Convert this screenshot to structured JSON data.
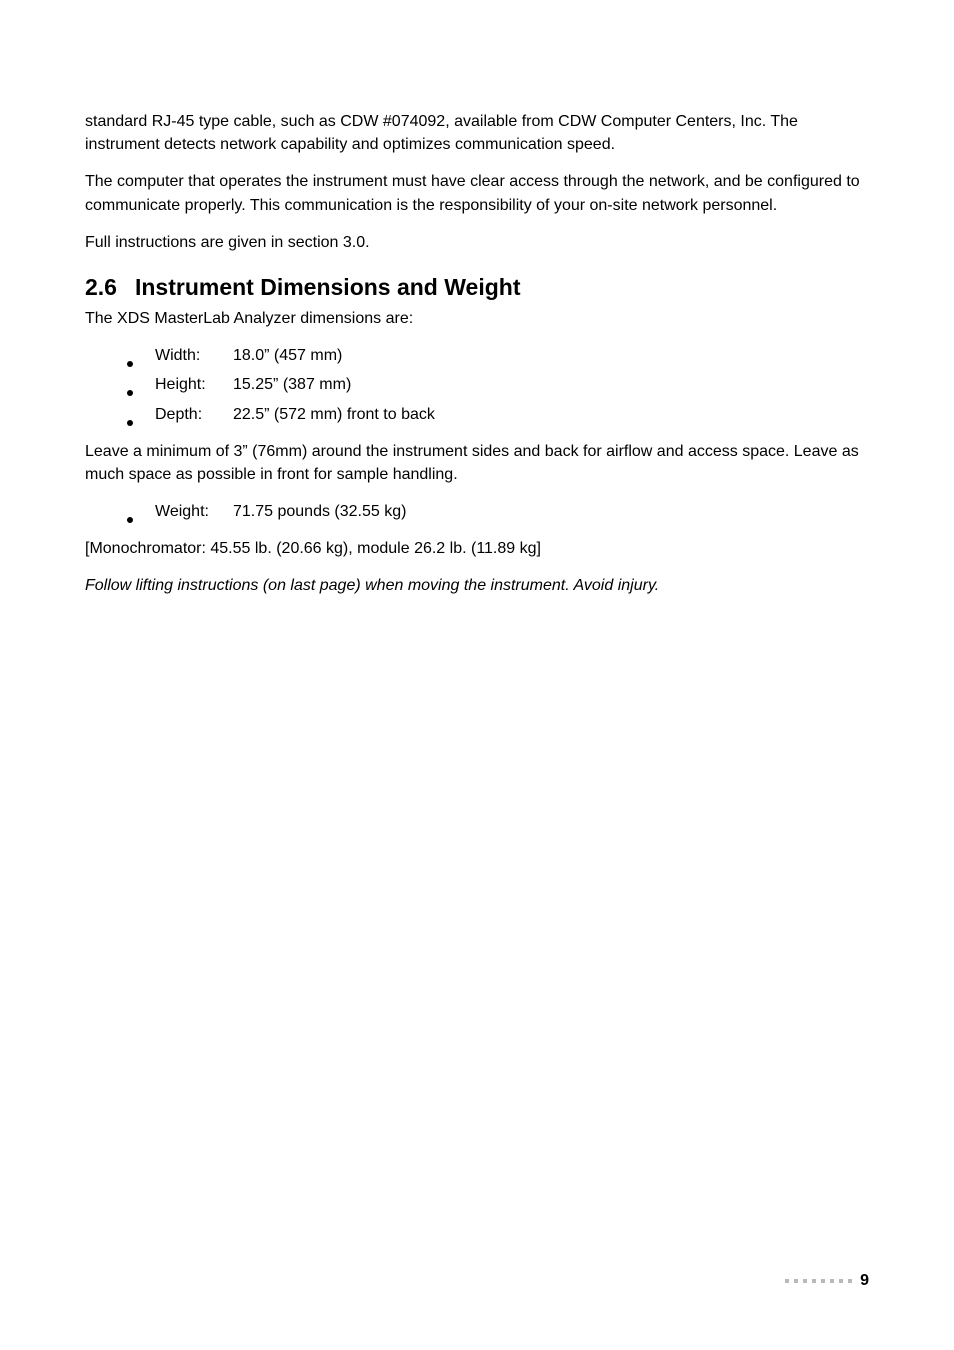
{
  "paragraphs": {
    "p1": "standard RJ-45 type cable, such as CDW #074092, available from CDW Computer Centers, Inc. The instrument detects network capability and optimizes communication speed.",
    "p2": "The computer that operates the instrument must have clear access through the network, and be configured to communicate properly. This communication is the responsibility of your on-site network personnel.",
    "p3": "Full instructions are given in section 3.0."
  },
  "heading": {
    "number": "2.6",
    "title": "Instrument Dimensions and Weight"
  },
  "intro": "The XDS MasterLab Analyzer dimensions are:",
  "spec_dimensions": [
    {
      "label": "Width:",
      "value": "18.0” (457 mm)"
    },
    {
      "label": "Height:",
      "value": "15.25” (387 mm)"
    },
    {
      "label": "Depth:",
      "value": "22.5” (572 mm) front to back"
    }
  ],
  "spacing_note": "Leave a minimum of 3” (76mm) around the instrument sides and back for airflow and access space. Leave as much space as possible in front for sample handling.",
  "spec_weight": [
    {
      "label": "Weight:",
      "value": "71.75 pounds (32.55 kg)"
    }
  ],
  "mono_line": "[Monochromator: 45.55 lb. (20.66 kg), module 26.2 lb. (11.89  kg]",
  "lifting_note": "Follow lifting instructions (on last page) when moving the instrument. Avoid injury.",
  "page_number": "9"
}
